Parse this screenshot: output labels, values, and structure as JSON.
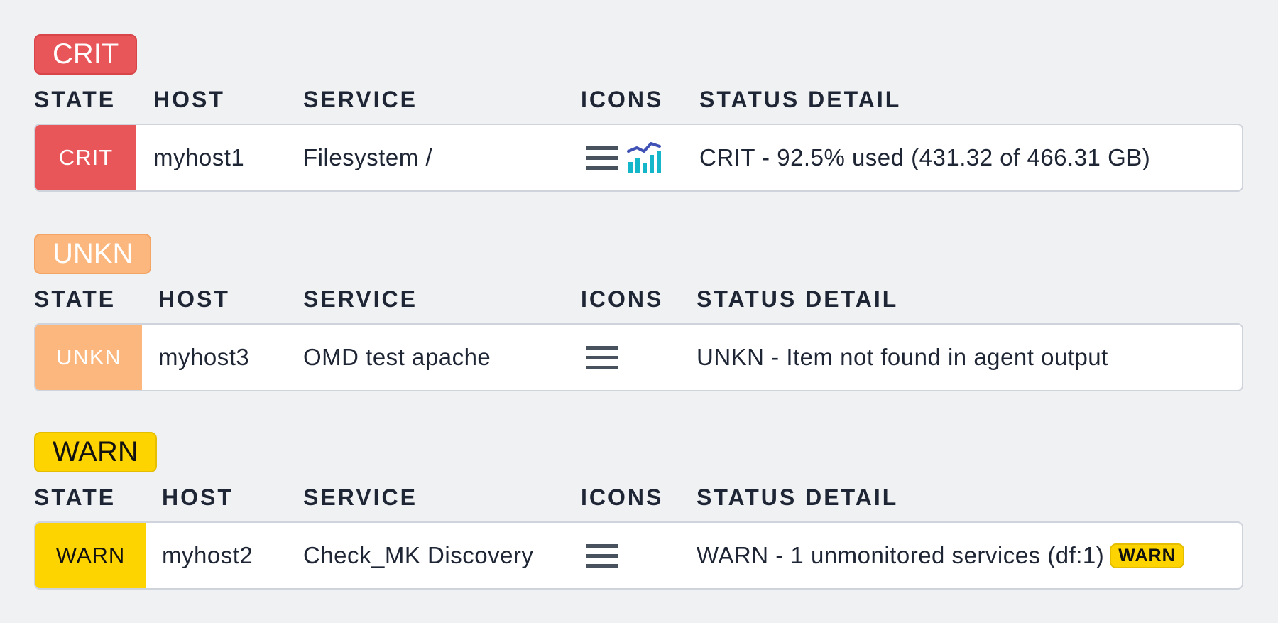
{
  "columns": {
    "state": "STATE",
    "host": "HOST",
    "service": "SERVICE",
    "icons": "ICONS",
    "status_detail": "STATUS DETAIL"
  },
  "groups": [
    {
      "badge": "CRIT",
      "row": {
        "state": "CRIT",
        "host": "myhost1",
        "service": "Filesystem /",
        "icons": [
          "menu-icon",
          "graph-icon"
        ],
        "status_detail": "CRIT - 92.5% used (431.32 of 466.31 GB)"
      }
    },
    {
      "badge": "UNKN",
      "row": {
        "state": "UNKN",
        "host": "myhost3",
        "service": "OMD test apache",
        "icons": [
          "menu-icon"
        ],
        "status_detail": "UNKN - Item not found in agent output"
      }
    },
    {
      "badge": "WARN",
      "row": {
        "state": "WARN",
        "host": "myhost2",
        "service": "Check_MK Discovery",
        "icons": [
          "menu-icon"
        ],
        "status_detail": "WARN - 1 unmonitored services (df:1)",
        "status_badge": "WARN"
      }
    }
  ],
  "colors": {
    "crit": "#e8565a",
    "unkn": "#fbb77d",
    "warn": "#fed400",
    "background": "#f0f1f3"
  }
}
